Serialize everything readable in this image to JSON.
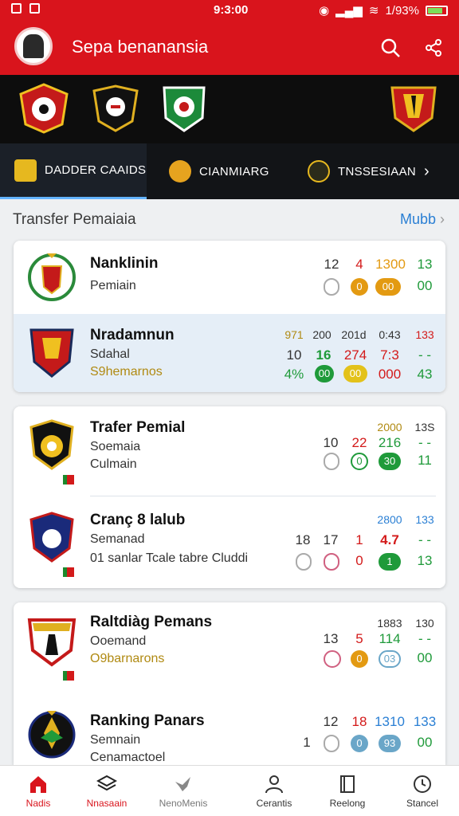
{
  "status_bar": {
    "time": "9:3:00",
    "battery": "1/93%"
  },
  "app_bar": {
    "title": "Sepa benanansia"
  },
  "tabs": [
    {
      "label": "DADDER CAAIDS",
      "active": true,
      "icon": "shield-icon"
    },
    {
      "label": "CIANMIARG",
      "active": false,
      "icon": "flame-icon"
    },
    {
      "label": "TNSSESIAAN",
      "active": false,
      "icon": "ball-icon"
    }
  ],
  "section": {
    "title": "Transfer Pemaiaia",
    "link": "Mubb"
  },
  "cards": [
    {
      "rows": [
        {
          "name": "Nanklinin",
          "sub1": "Pemiain",
          "sub2": "",
          "stats_top": [
            "12",
            "4",
            "1300",
            "13"
          ],
          "stats_bottom": [
            "",
            "0",
            "00",
            "00"
          ],
          "highlight": false
        },
        {
          "name": "Nradamnun",
          "sub1": "Sdahal",
          "sub2": "S9hemarnos",
          "stats_head": [
            "971",
            "200",
            "201d",
            "0:43",
            "133"
          ],
          "stats_top": [
            "10",
            "16",
            "274",
            "7:3",
            "- -"
          ],
          "stats_bottom": [
            "4%",
            "00",
            "00",
            "000",
            "43"
          ],
          "highlight": true
        }
      ]
    },
    {
      "rows": [
        {
          "name": "Trafer Pemial",
          "sub1": "Soemaia",
          "sub2": "Culmain",
          "stats_head": [
            "2000",
            "13S"
          ],
          "stats_top": [
            "10",
            "22",
            "216",
            "- -"
          ],
          "stats_bottom": [
            "",
            "0",
            "30",
            "11"
          ],
          "highlight": false
        },
        {
          "name": "Cranç 8 lalub",
          "sub1": "Semanad",
          "sub2": "01 sanlar Tcale tabre Cluddi",
          "stats_head": [
            "2800",
            "133"
          ],
          "stats_top": [
            "18",
            "17",
            "1",
            "4.7",
            "- -"
          ],
          "stats_bottom": [
            "",
            "",
            "0",
            "1",
            "13"
          ],
          "highlight": false
        }
      ]
    },
    {
      "rows": [
        {
          "name": "Raltdiàg Pemans",
          "sub1": "Ooemand",
          "sub2": "O9barnarons",
          "stats_head": [
            "1883",
            "130"
          ],
          "stats_top": [
            "13",
            "5",
            "114",
            "- -"
          ],
          "stats_bottom": [
            "",
            "0",
            "03",
            "00"
          ],
          "highlight": false
        },
        {
          "name": "Ranking Panars",
          "sub1": "Semnain",
          "sub2": "Cenamactoel",
          "stats_head": [
            "12",
            "18",
            "1310",
            "133"
          ],
          "stats_top": [
            "1",
            "",
            "0",
            "93",
            "00"
          ],
          "stats_bottom": [],
          "highlight": false
        }
      ]
    }
  ],
  "bottom_nav": [
    {
      "label": "Nadis",
      "icon": "home-icon",
      "active": true
    },
    {
      "label": "Nnasaain",
      "icon": "layers-icon",
      "active": true
    },
    {
      "label": "NenoMenis",
      "icon": "bird-icon",
      "active": false
    },
    {
      "label": "Cerantis",
      "icon": "person-icon",
      "active": false
    },
    {
      "label": "Reelong",
      "icon": "book-icon",
      "active": false
    },
    {
      "label": "Stancel",
      "icon": "clock-icon",
      "active": false
    }
  ],
  "colors": {
    "brand_red": "#d9141c",
    "header_dark": "#0d0d0d",
    "accent_blue": "#2a7fd4",
    "green": "#1f9a3a",
    "orange": "#e39a12",
    "red": "#d31a1a"
  }
}
